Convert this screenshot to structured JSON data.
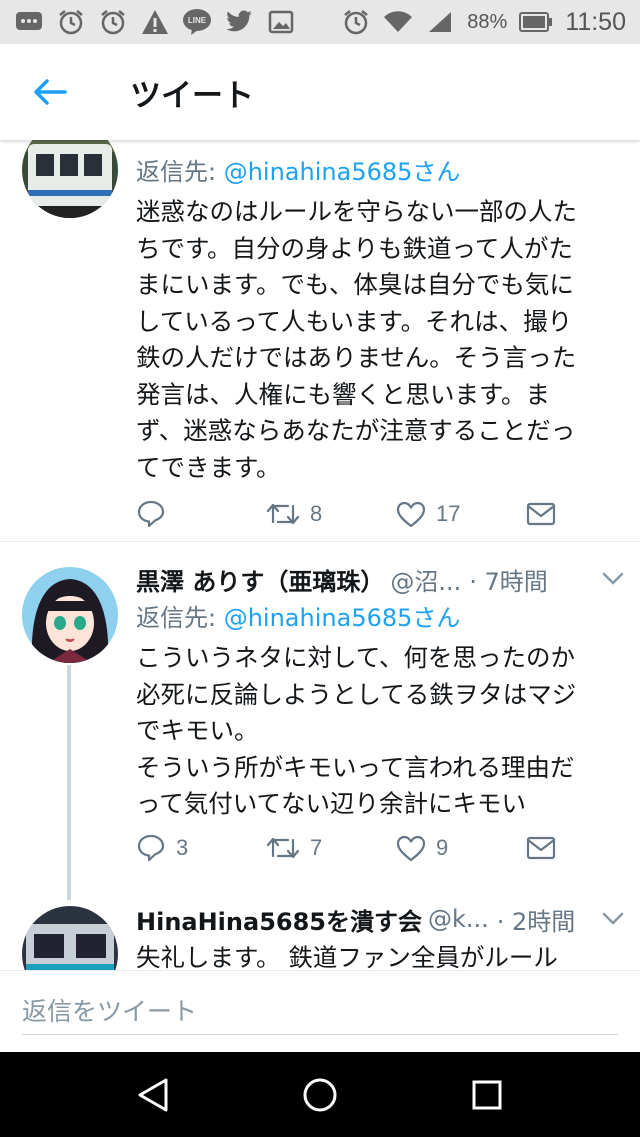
{
  "status_bar": {
    "icons": [
      "message-icon",
      "alarm-icon",
      "alarm-icon",
      "warning-icon",
      "line-app-icon",
      "twitter-icon",
      "image-icon",
      "alarm-icon",
      "wifi-icon",
      "signal-icon",
      "battery-icon"
    ],
    "battery": "88%",
    "time": "11:50"
  },
  "header": {
    "title": "ツイート"
  },
  "tweets": [
    {
      "reply_prefix": "返信先: ",
      "reply_mention": "@hinahina5685さん",
      "lines": [
        "迷惑なのはルールを守らない一部の人た",
        "ちです。自分の身よりも鉄道って人がた",
        "まにいます。でも、体臭は自分でも気に",
        "しているって人もいます。それは、撮り",
        "鉄の人だけではありません。そう言った",
        "発言は、人権にも響くと思います。ま",
        "ず、迷惑ならあなたが注意することだっ",
        "てできます。"
      ],
      "reply_count": "",
      "retweet_count": "8",
      "like_count": "17"
    },
    {
      "author": "黒澤 ありす（亜璃珠）",
      "handle": "@沼...",
      "time": "· 7時間",
      "reply_prefix": "返信先: ",
      "reply_mention": "@hinahina5685さん",
      "lines": [
        "こういうネタに対して、何を思ったのか",
        "必死に反論しようとしてる鉄ヲタはマジ",
        "でキモい。",
        "そういう所がキモいって言われる理由だ",
        "って気付いてない辺り余計にキモい"
      ],
      "reply_count": "3",
      "retweet_count": "7",
      "like_count": "9"
    },
    {
      "author": "HinaHina5685を潰す会",
      "handle": "@k...",
      "time": "· 2時間",
      "lines": [
        "失礼します。 鉄道ファン全員がルール"
      ]
    }
  ],
  "reply_bar": {
    "placeholder": "返信をツイート"
  },
  "colors": {
    "accent": "#1da1f2",
    "text": "#14171a",
    "secondary": "#657786"
  }
}
